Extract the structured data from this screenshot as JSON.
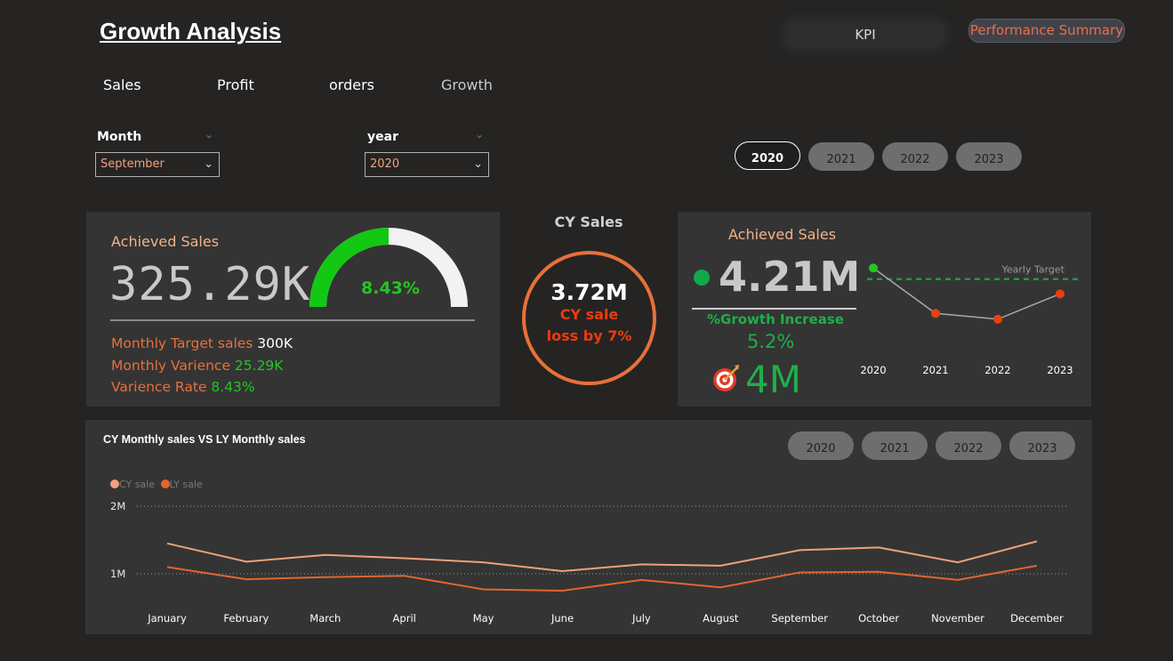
{
  "header": {
    "title": "Growth Analysis",
    "kpi_button": "KPI",
    "performance_button": "Performance Summary"
  },
  "nav": {
    "tabs": [
      {
        "label": "Sales"
      },
      {
        "label": "Profit"
      },
      {
        "label": "orders"
      },
      {
        "label": "Growth"
      }
    ]
  },
  "slicers": {
    "month": {
      "label": "Month",
      "value": "September"
    },
    "year": {
      "label": "year",
      "value": "2020"
    }
  },
  "year_pills_top": {
    "items": [
      "2020",
      "2021",
      "2022",
      "2023"
    ],
    "selected": "2020"
  },
  "achieved_card": {
    "title": "Achieved Sales",
    "value": "325.29K",
    "gauge_percent_label": "8.43%",
    "gauge_fraction": 0.0843,
    "target_label": "Monthly Target sales",
    "target_value": "300K",
    "variance_label": "Monthly Varience",
    "variance_value": "25.29K",
    "rate_label": "Varience Rate",
    "rate_value": "8.43%"
  },
  "cy_sales": {
    "title": "CY Sales",
    "value": "3.72M",
    "line1": "CY sale",
    "line2": "loss by 7%"
  },
  "yearly_card": {
    "title": "Achieved Sales",
    "value": "4.21M",
    "growth_label": "%Growth Increase",
    "growth_value": "5.2%",
    "target_value": "4M",
    "target_line_label": "Yearly Target",
    "chart_data": {
      "type": "line",
      "x": [
        "2020",
        "2021",
        "2022",
        "2023"
      ],
      "values": [
        4.21,
        3.35,
        3.24,
        3.72
      ],
      "target": 4.0,
      "point_colors": [
        "#22c722",
        "#e8400e",
        "#e8400e",
        "#e8400e"
      ]
    }
  },
  "monthly_chart": {
    "title": "CY Monthly sales VS LY Monthly sales",
    "year_pills": [
      "2020",
      "2021",
      "2022",
      "2023"
    ],
    "legend": [
      {
        "name": "CY sale",
        "color": "#f0a07a"
      },
      {
        "name": "LY sale",
        "color": "#e0672e"
      }
    ],
    "chart_data": {
      "type": "line",
      "categories": [
        "January",
        "February",
        "March",
        "April",
        "May",
        "June",
        "July",
        "August",
        "September",
        "October",
        "November",
        "December"
      ],
      "series": [
        {
          "name": "CY sale",
          "color": "#f0a07a",
          "values": [
            1.45,
            1.18,
            1.28,
            1.23,
            1.17,
            1.04,
            1.14,
            1.12,
            1.35,
            1.39,
            1.17,
            1.48
          ]
        },
        {
          "name": "LY sale",
          "color": "#e0672e",
          "values": [
            1.1,
            0.92,
            0.95,
            0.97,
            0.77,
            0.75,
            0.91,
            0.8,
            1.02,
            1.03,
            0.91,
            1.12
          ]
        }
      ],
      "yticks": [
        {
          "value": 1.0,
          "label": "1M"
        },
        {
          "value": 2.0,
          "label": "2M"
        }
      ],
      "ylim": [
        0.5,
        2.0
      ],
      "grid": true,
      "legend_position": "top-left"
    }
  }
}
